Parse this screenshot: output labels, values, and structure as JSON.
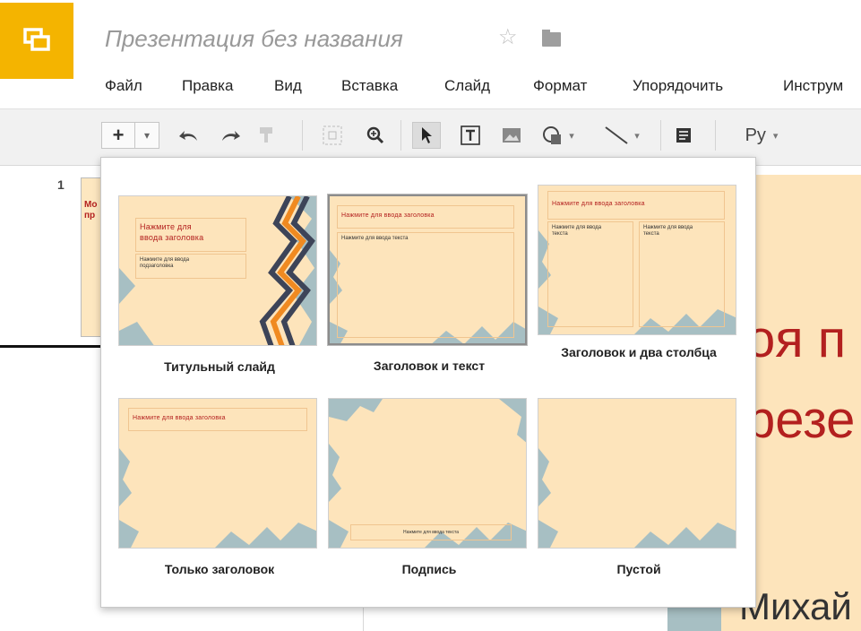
{
  "header": {
    "doc_title": "Презентация без названия",
    "star": "☆"
  },
  "menu": [
    "Файл",
    "Правка",
    "Вид",
    "Вставка",
    "Слайд",
    "Формат",
    "Упорядочить",
    "Инструм"
  ],
  "toolbar": {
    "new_slide": "+",
    "dropdown_arrow": "▾",
    "input_tools_label": "Ру"
  },
  "filmstrip": {
    "slide_number": "1",
    "thumb_text_line1": "Мо",
    "thumb_text_line2": "пр"
  },
  "canvas": {
    "title_line1": "оя п",
    "title_line2": "резе",
    "author": "Михай"
  },
  "layouts": [
    {
      "label": "Титульный слайд",
      "title_placeholder": "Нажмите для ввода заголовка",
      "title_line1": "Нажмите для",
      "title_line2": "ввода заголовка",
      "subtitle_line1": "Нажмите для ввода",
      "subtitle_line2": "подзаголовка"
    },
    {
      "label": "Заголовок и текст",
      "title_placeholder": "Нажмите для ввода заголовка",
      "body_placeholder": "Нажмите для ввода текста"
    },
    {
      "label": "Заголовок и два столбца",
      "title_placeholder": "Нажмите для ввода заголовка",
      "col1_line1": "Нажмите для ввода",
      "col1_line2": "текста",
      "col2_line1": "Нажмите для ввода",
      "col2_line2": "текста"
    },
    {
      "label": "Только заголовок",
      "title_placeholder": "Нажмите для ввода заголовка"
    },
    {
      "label": "Подпись",
      "caption_placeholder": "Нажмите для ввода текста"
    },
    {
      "label": "Пустой"
    }
  ],
  "colors": {
    "accent": "#f4b400",
    "slide_bg": "#fde4bb",
    "title_red": "#b3201f",
    "zigzag_blue": "#a7bfc3"
  }
}
